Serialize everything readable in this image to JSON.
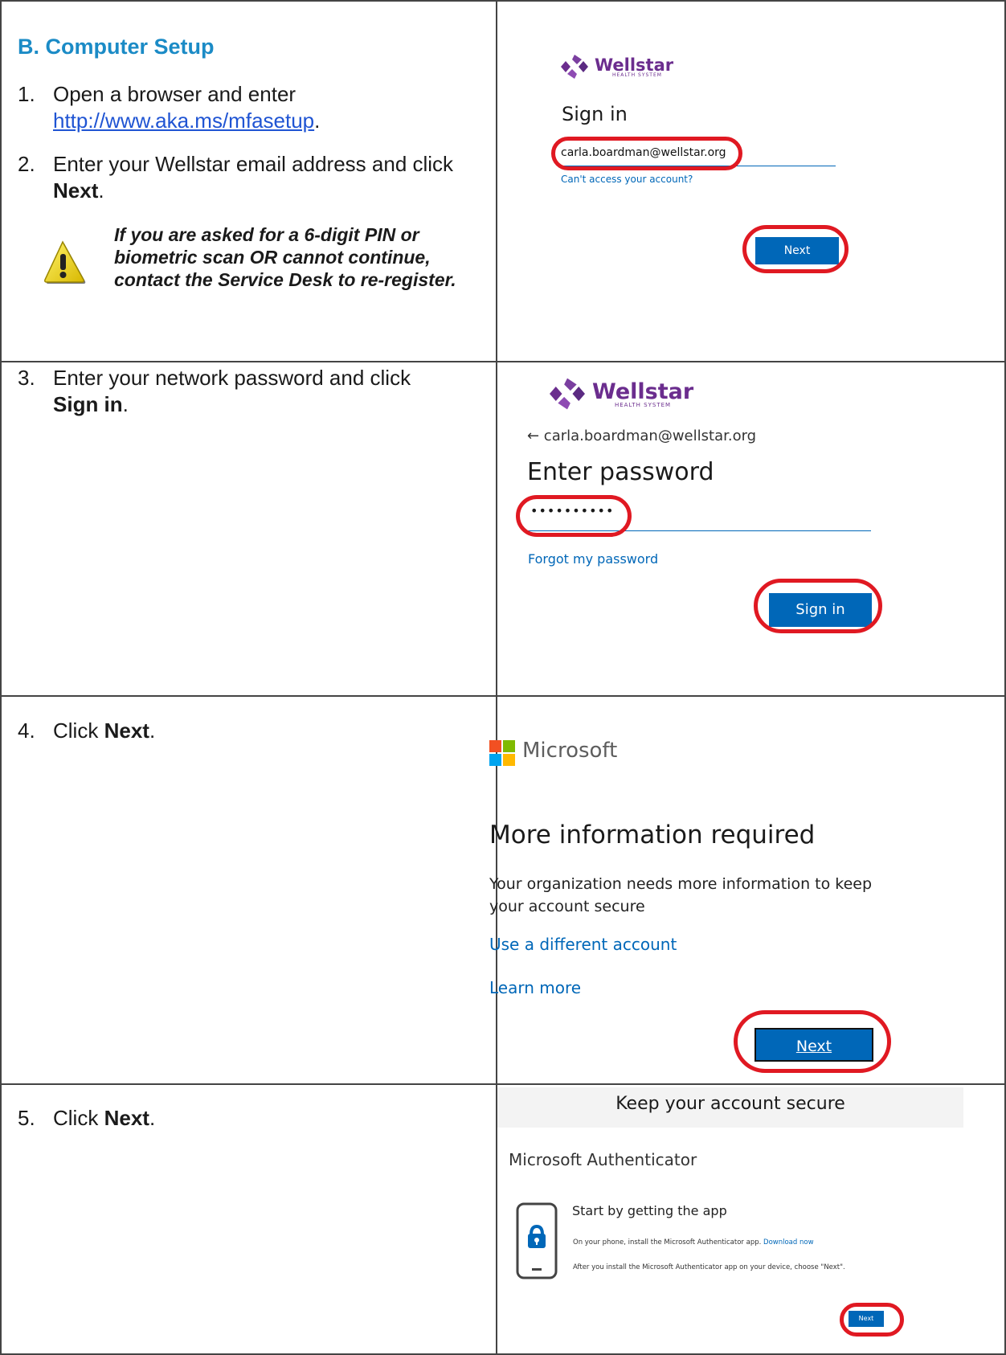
{
  "heading": "B.  Computer Setup",
  "steps": [
    {
      "num": "1.",
      "pre": "Open a browser and enter",
      "link": "http://www.aka.ms/mfasetup",
      "post": "."
    },
    {
      "num": "2.",
      "pre": "Enter your Wellstar email address and click",
      "bold": "Next",
      "post": "."
    },
    {
      "num": "3.",
      "pre": "Enter your network password and click",
      "bold": "Sign in",
      "post": "."
    },
    {
      "num": "4.",
      "pre": "Click",
      "bold": "Next",
      "post": "."
    },
    {
      "num": "5.",
      "pre": "Click",
      "bold": "Next",
      "post": "."
    }
  ],
  "warning": "If you are asked for a 6-digit PIN or biometric scan OR cannot continue, contact the Service Desk to re-register.",
  "shot1": {
    "logo": "Wellstar",
    "logo_sub": "HEALTH SYSTEM",
    "title": "Sign in",
    "email": "carla.boardman@wellstar.org",
    "link": "Can't access your account?",
    "button": "Next"
  },
  "shot2": {
    "logo": "Wellstar",
    "logo_sub": "HEALTH SYSTEM",
    "back": "← carla.boardman@wellstar.org",
    "title": "Enter password",
    "password": "••••••••••",
    "link": "Forgot my password",
    "button": "Sign in"
  },
  "shot3": {
    "brand": "Microsoft",
    "title": "More information required",
    "body": "Your organization needs more information to keep your account secure",
    "link1": "Use a different account",
    "link2": "Learn more",
    "button": "Next"
  },
  "shot4": {
    "header": "Keep your account secure",
    "app": "Microsoft Authenticator",
    "sub": "Start by getting the app",
    "line1": "On your phone, install the Microsoft Authenticator app.",
    "line1_link": "Download now",
    "line2": "After you install the Microsoft Authenticator app on your device, choose \"Next\".",
    "button": "Next"
  },
  "colors": {
    "heading": "#1b8bc6",
    "ms_blue": "#0067b8",
    "wellstar": "#6b2d8e",
    "ring": "#e01922"
  },
  "icons": {
    "warning": "warning-icon",
    "wellstar_logo": "wellstar-logo-icon",
    "microsoft_logo": "microsoft-logo-icon",
    "phone_lock": "phone-lock-icon"
  }
}
